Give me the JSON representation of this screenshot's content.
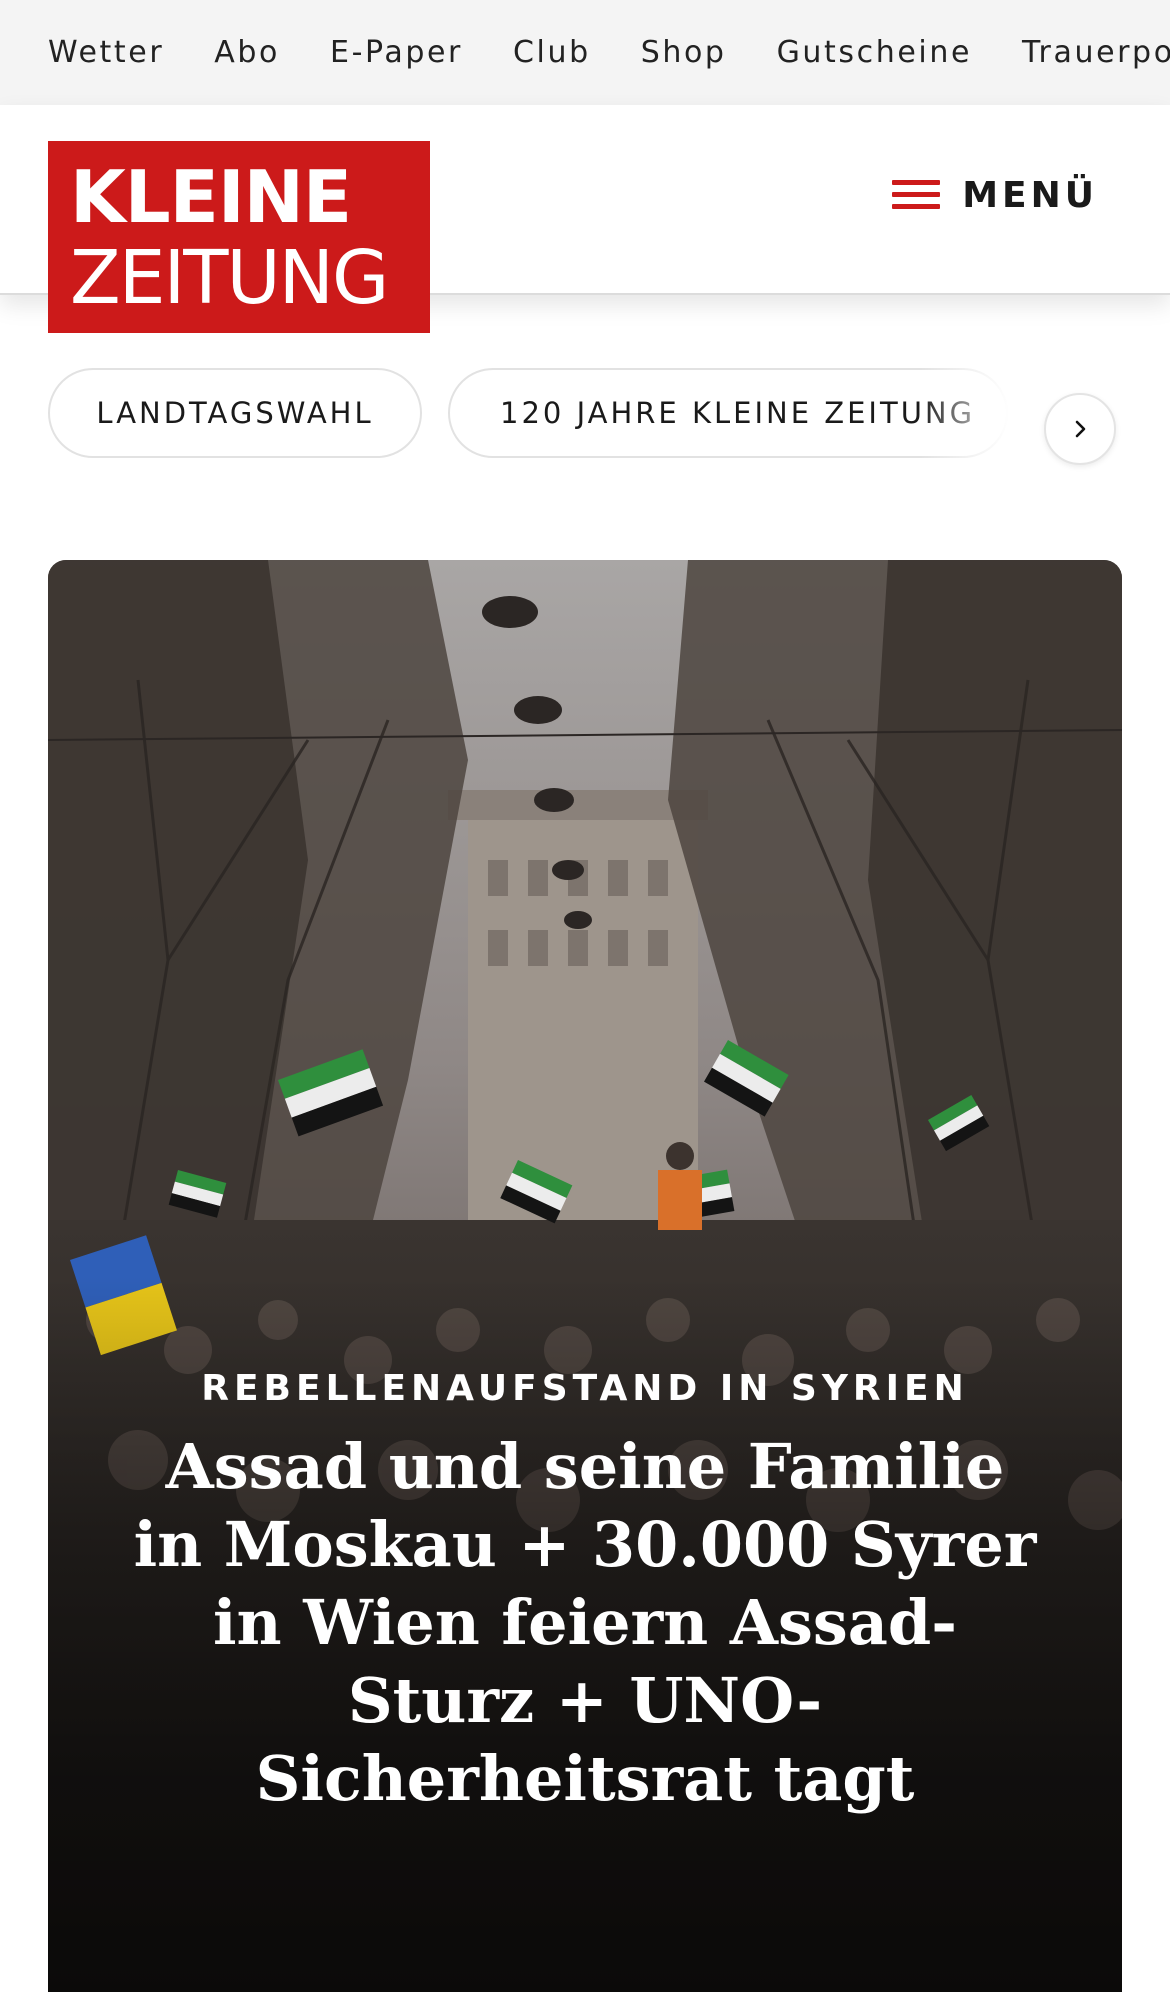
{
  "topnav": {
    "items": [
      "Wetter",
      "Abo",
      "E-Paper",
      "Club",
      "Shop",
      "Gutscheine",
      "Trauerpo"
    ]
  },
  "header": {
    "logo_line1": "KLEINE",
    "logo_line2": "ZEITUNG",
    "menu_label": "MENÜ",
    "brand_color": "#cc1a1a"
  },
  "topics": {
    "pills": [
      "LANDTAGSWAHL",
      "120 JAHRE KLEINE ZEITUNG"
    ],
    "next_icon": "chevron-right-icon"
  },
  "hero": {
    "kicker": "REBELLENAUFSTAND IN SYRIEN",
    "headline": "Assad und seine Familie in Moskau + 30.000 Syrer in Wien feiern Assad-Sturz + UNO-Sicherheitsrat tagt"
  }
}
